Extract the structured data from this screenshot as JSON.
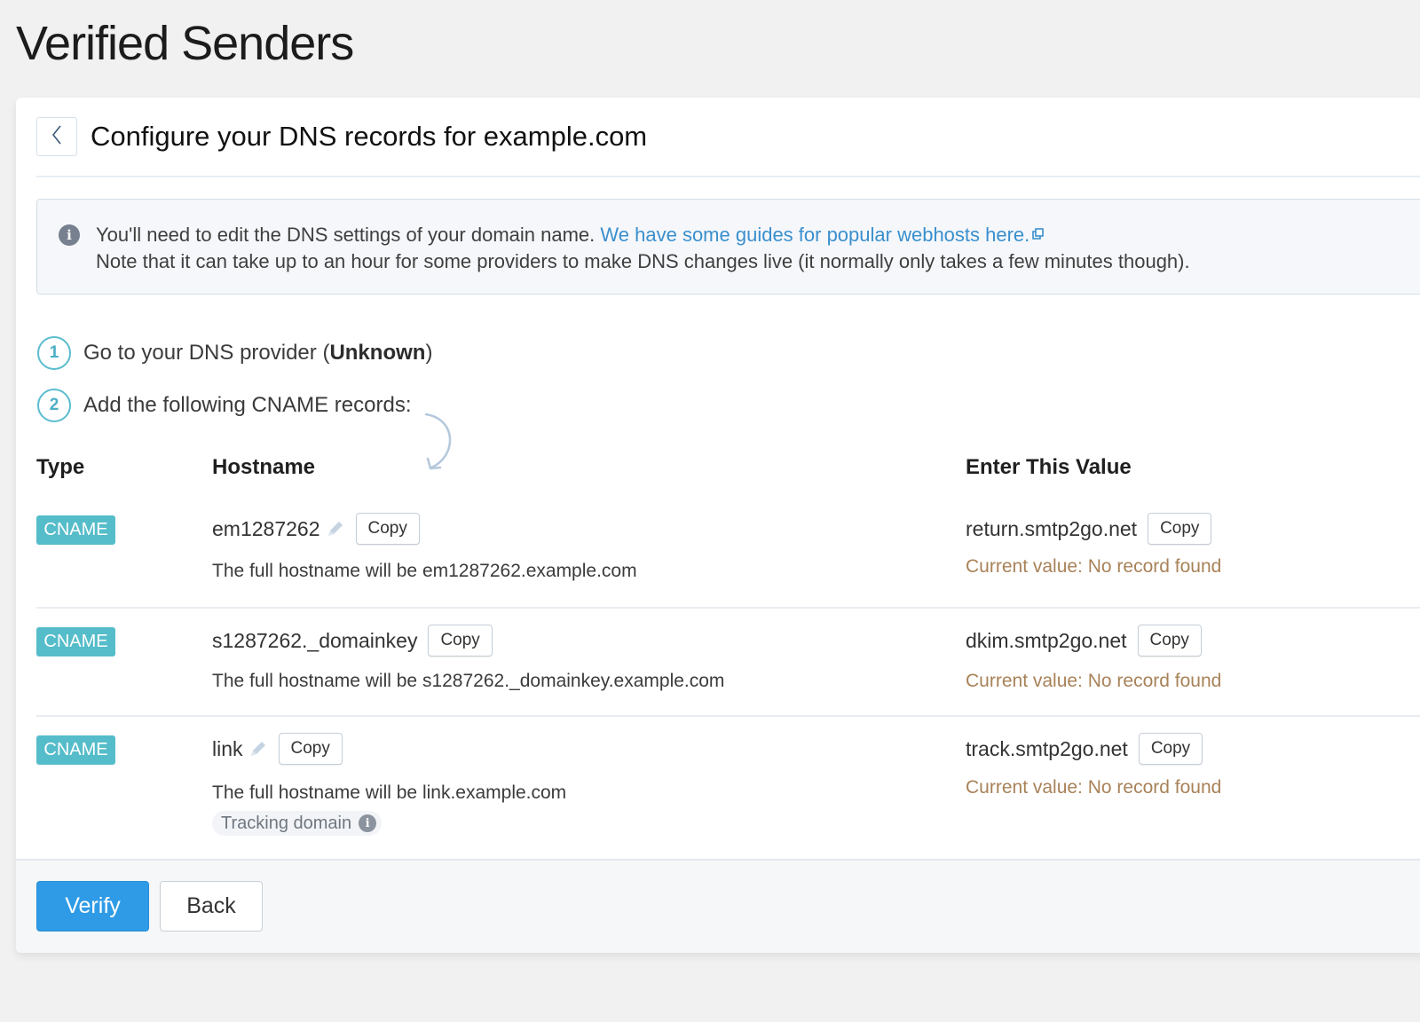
{
  "page": {
    "title": "Verified Senders"
  },
  "card": {
    "title": "Configure your DNS records for example.com",
    "back_icon": "chevron-left-icon"
  },
  "info": {
    "icon": "info-icon",
    "line1_text": "You'll need to edit the DNS settings of your domain name.",
    "link_text": "We have some guides for popular webhosts here.",
    "link_icon": "external-link-icon",
    "line2_text": "Note that it can take up to an hour for some providers to make DNS changes live (it normally only takes a few minutes though)."
  },
  "steps": [
    {
      "number": "1",
      "text": "Go to your DNS provider (",
      "bold": "Unknown",
      "suffix": ")"
    },
    {
      "number": "2",
      "text": "Add the following CNAME records:"
    }
  ],
  "table": {
    "headers": {
      "type": "Type",
      "hostname": "Hostname",
      "value": "Enter This Value"
    },
    "records": [
      {
        "type": "CNAME",
        "hostname": "em1287262",
        "editable": true,
        "copy_label": "Copy",
        "full_hostname": "The full hostname will be em1287262.example.com",
        "value": "return.smtp2go.net",
        "value_copy_label": "Copy",
        "current_value": "Current value: No record found"
      },
      {
        "type": "CNAME",
        "hostname": "s1287262._domainkey",
        "editable": false,
        "copy_label": "Copy",
        "full_hostname": "The full hostname will be s1287262._domainkey.example.com",
        "value": "dkim.smtp2go.net",
        "value_copy_label": "Copy",
        "current_value": "Current value: No record found"
      },
      {
        "type": "CNAME",
        "hostname": "link",
        "editable": true,
        "copy_label": "Copy",
        "full_hostname": "The full hostname will be link.example.com",
        "tag": "Tracking domain",
        "value": "track.smtp2go.net",
        "value_copy_label": "Copy",
        "current_value": "Current value: No record found"
      }
    ]
  },
  "footer": {
    "verify_label": "Verify",
    "back_label": "Back"
  },
  "colors": {
    "accent": "#2f9be6",
    "badge": "#55bcca",
    "link": "#3a8fcd",
    "warning_text": "#a88258",
    "step_circle": "#5bbccf"
  }
}
